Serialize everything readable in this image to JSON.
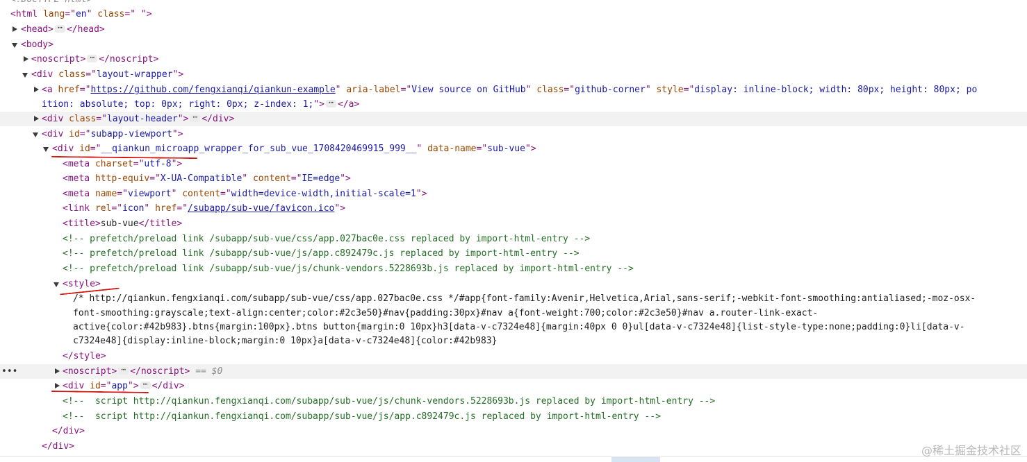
{
  "doctype": "<!DOCTYPE html>",
  "lines": {
    "html_open": {
      "tag": "html",
      "attrs": [
        [
          "lang",
          "en"
        ],
        [
          "class",
          " "
        ]
      ]
    },
    "head": {
      "tag": "head"
    },
    "body_open": {
      "tag": "body"
    },
    "noscript1": {
      "tag": "noscript"
    },
    "layout_wrapper": {
      "tag": "div",
      "attrs": [
        [
          "class",
          "layout-wrapper"
        ]
      ]
    },
    "github_a": {
      "open_a": "<a",
      "href_name": "href",
      "href_val": "https://github.com/fengxianqi/qiankun-example",
      "aria_name": "aria-label",
      "aria_val": "View source on GitHub",
      "class_name": "class",
      "class_val": "github-corner",
      "style_name": "style",
      "style_val_1": "display: inline-block; width: 80px; height: 80px; po",
      "style_val_2": "ition: absolute; top: 0px; right: 0px; z-index: 1;",
      "close": "</a>"
    },
    "layout_header": {
      "tag": "div",
      "attrs": [
        [
          "class",
          "layout-header"
        ]
      ]
    },
    "subapp_viewport": {
      "tag": "div",
      "attrs": [
        [
          "id",
          "subapp-viewport"
        ]
      ]
    },
    "qiankun_div": {
      "id_val": "__qiankun_microapp_wrapper_for_sub_vue_1708420469915_999__",
      "dn_name": "data-name",
      "dn_val": "sub-vue"
    },
    "meta_charset": {
      "name": "charset",
      "val": "utf-8"
    },
    "meta_http": {
      "n1": "http-equiv",
      "v1": "X-UA-Compatible",
      "n2": "content",
      "v2": "IE=edge"
    },
    "meta_viewport": {
      "n1": "name",
      "v1": "viewport",
      "n2": "content",
      "v2": "width=device-width,initial-scale=1"
    },
    "link_icon": {
      "n1": "rel",
      "v1": "icon",
      "n2": "href",
      "v2": "/subapp/sub-vue/favicon.ico"
    },
    "title": {
      "text": "sub-vue"
    },
    "comment1": "<!-- prefetch/preload link /subapp/sub-vue/css/app.027bac0e.css replaced by import-html-entry -->",
    "comment2": "<!-- prefetch/preload link /subapp/sub-vue/js/app.c892479c.js replaced by import-html-entry -->",
    "comment3": "<!-- prefetch/preload link /subapp/sub-vue/js/chunk-vendors.5228693b.js replaced by import-html-entry -->",
    "style_tag": "<style>",
    "css1": "/* http://qiankun.fengxianqi.com/subapp/sub-vue/css/app.027bac0e.css */#app{font-family:Avenir,Helvetica,Arial,sans-serif;-webkit-font-smoothing:antialiased;-moz-osx-",
    "css2": "font-smoothing:grayscale;text-align:center;color:#2c3e50}#nav{padding:30px}#nav a{font-weight:700;color:#2c3e50}#nav a.router-link-exact-",
    "css3": "active{color:#42b983}.btns{margin:100px}.btns button{margin:0 10px}h3[data-v-c7324e48]{margin:40px 0 0}ul[data-v-c7324e48]{list-style-type:none;padding:0}li[data-v-",
    "css4": "c7324e48]{display:inline-block;margin:0 10px}a[data-v-c7324e48]{color:#42b983}",
    "style_close": "</style>",
    "noscript2_suffix": "== $0",
    "app_div": {
      "id_val": "app"
    },
    "comment4": "<!--  script http://qiankun.fengxianqi.com/subapp/sub-vue/js/chunk-vendors.5228693b.js replaced by import-html-entry -->",
    "comment5": "<!--  script http://qiankun.fengxianqi.com/subapp/sub-vue/js/app.c892479c.js replaced by import-html-entry -->",
    "div_close": "</div>"
  },
  "ellipsis": "⋯",
  "gutter_ellipsis": "•••",
  "watermark": "@稀土掘金技术社区"
}
